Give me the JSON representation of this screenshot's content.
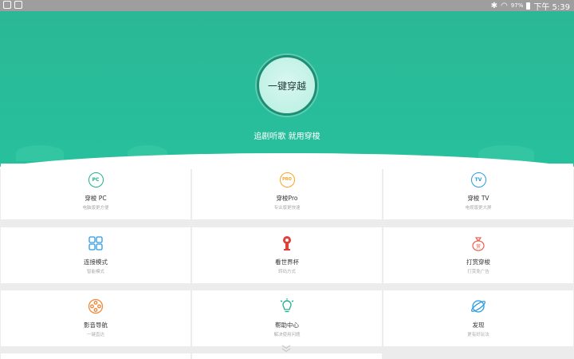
{
  "status": {
    "battery": "97%",
    "time": "下午 5:39"
  },
  "hero": {
    "button_label": "一键穿越",
    "slogan": "追剧听歌 就用穿梭"
  },
  "tiles": [
    {
      "title": "穿梭 PC",
      "subtitle": "电脑版更方便",
      "icon": "pc-icon",
      "icon_text": "PC",
      "color": "#20b090"
    },
    {
      "title": "穿梭Pro",
      "subtitle": "专业版更快速",
      "icon": "pro-icon",
      "icon_text": "PRO",
      "color": "#f5a623"
    },
    {
      "title": "穿梭 TV",
      "subtitle": "电视版更大屏",
      "icon": "tv-icon",
      "icon_text": "TV",
      "color": "#2a9be0"
    },
    {
      "title": "连接模式",
      "subtitle": "智能模式",
      "icon": "grid-icon",
      "icon_text": "",
      "color": "#2a9be0"
    },
    {
      "title": "看世界杯",
      "subtitle": "转码方式",
      "icon": "worldcup-icon",
      "icon_text": "",
      "color": "#e0403a"
    },
    {
      "title": "打赏穿梭",
      "subtitle": "打赏免广告",
      "icon": "money-bag-icon",
      "icon_text": "赏",
      "color": "#f06050"
    },
    {
      "title": "影音导航",
      "subtitle": "一键直达",
      "icon": "film-reel-icon",
      "icon_text": "",
      "color": "#f08a3c"
    },
    {
      "title": "帮助中心",
      "subtitle": "解决使用问题",
      "icon": "lightbulb-icon",
      "icon_text": "",
      "color": "#20b090"
    },
    {
      "title": "发现",
      "subtitle": "更有好玩法",
      "icon": "planet-icon",
      "icon_text": "",
      "color": "#2a9be0"
    }
  ]
}
